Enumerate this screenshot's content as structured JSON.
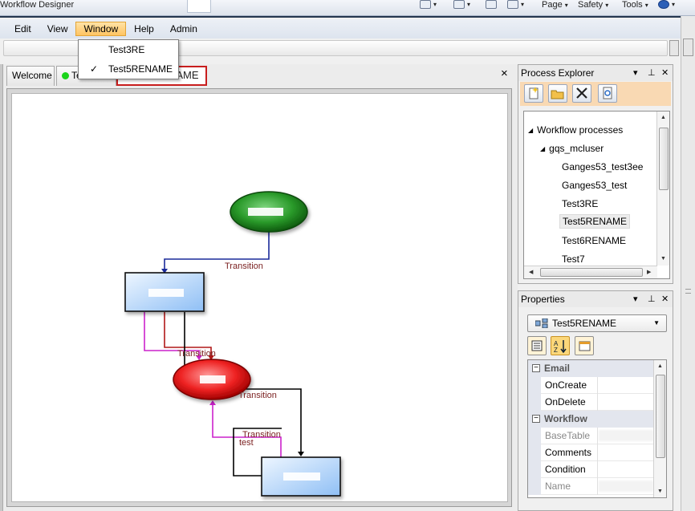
{
  "ie_bar": {
    "title": "Workflow Designer",
    "page_label": "Page",
    "safety_label": "Safety",
    "tools_label": "Tools"
  },
  "menubar": {
    "items": [
      "Edit",
      "View",
      "Window",
      "Help",
      "Admin"
    ],
    "active": "Window"
  },
  "window_menu": {
    "items": [
      {
        "label": "Test3RE",
        "checked": false
      },
      {
        "label": "Test5RENAME",
        "checked": true
      }
    ]
  },
  "editor": {
    "tabs": [
      "Welcome",
      "Te",
      "NAME"
    ],
    "close_glyph": "×"
  },
  "diagram": {
    "labels": [
      "Transition",
      "Transition",
      "Transition",
      "Transition",
      "test"
    ]
  },
  "process_explorer": {
    "title": "Process Explorer",
    "tree": {
      "root": "Workflow processes",
      "group": "gqs_mcluser",
      "items": [
        "Ganges53_test3ee",
        "Ganges53_test",
        "Test3RE",
        "Test5RENAME",
        "Test6RENAME",
        "Test7"
      ],
      "selected": "Test5RENAME"
    }
  },
  "properties": {
    "title": "Properties",
    "selected_object": "Test5RENAME",
    "categories": [
      {
        "name": "Email",
        "props": [
          "OnCreate",
          "OnDelete"
        ]
      },
      {
        "name": "Workflow",
        "props": [
          "BaseTable",
          "Comments",
          "Condition",
          "Name"
        ]
      }
    ]
  },
  "colors": {
    "start_node": "#1f8a1f",
    "end_node": "#e01b1b",
    "task_node": "#9fc8f7",
    "transition_blue": "#1a2a9a",
    "transition_red": "#b01818",
    "transition_magenta": "#cc22cc",
    "label_color": "#7a1f1f",
    "pe_toolbar": "#f9d9b3"
  },
  "icons": {
    "pe_toolbar": [
      "new-document-icon",
      "open-folder-icon",
      "delete-icon",
      "refresh-icon"
    ],
    "prop_toolbar": [
      "categorized-icon",
      "alphabetical-icon",
      "property-pages-icon"
    ]
  }
}
